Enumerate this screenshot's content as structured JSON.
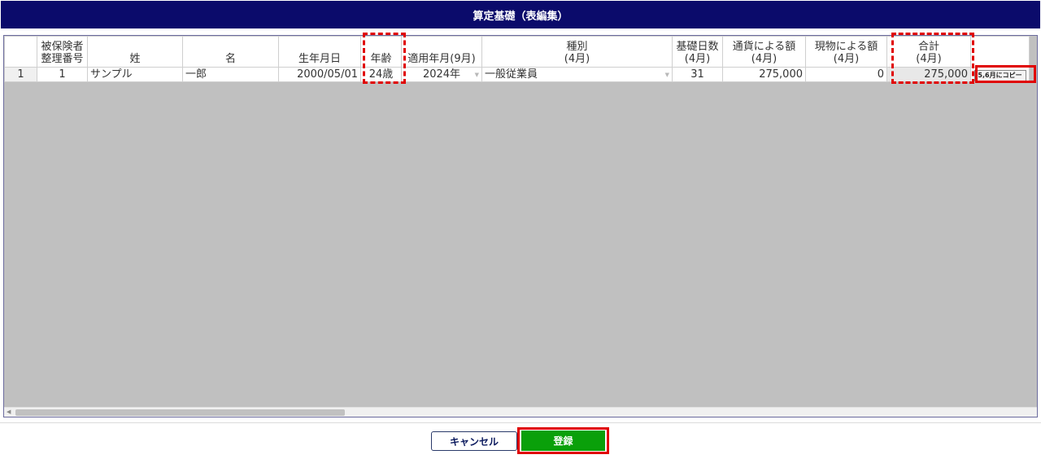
{
  "title": "算定基礎（表編集）",
  "columns": [
    {
      "key": "row",
      "label": ""
    },
    {
      "key": "insured_number",
      "label": "被保険者\n整理番号"
    },
    {
      "key": "last_name",
      "label": "姓"
    },
    {
      "key": "first_name",
      "label": "名"
    },
    {
      "key": "birth_date",
      "label": "生年月日"
    },
    {
      "key": "age",
      "label": "年齢"
    },
    {
      "key": "apply_month",
      "label": "適用年月(9月)"
    },
    {
      "key": "category",
      "label": "種別\n(4月)"
    },
    {
      "key": "base_days",
      "label": "基礎日数\n(4月)"
    },
    {
      "key": "currency_amount",
      "label": "通貨による額\n(4月)"
    },
    {
      "key": "goods_amount",
      "label": "現物による額\n(4月)"
    },
    {
      "key": "total",
      "label": "合計\n(4月)"
    },
    {
      "key": "action",
      "label": ""
    }
  ],
  "rows": [
    {
      "row": "1",
      "insured_number": "1",
      "last_name": "サンプル",
      "first_name": "一郎",
      "birth_date": "2000/05/01",
      "age": "24歳",
      "apply_month": "2024年",
      "category": "一般従業員",
      "base_days": "31",
      "currency_amount": "275,000",
      "goods_amount": "0",
      "total": "275,000",
      "action": "5,6月にコピー"
    }
  ],
  "buttons": {
    "cancel": "キャンセル",
    "register": "登録"
  },
  "colors": {
    "title_bar": "#0b0b6b",
    "register_button": "#0aa00a",
    "highlight": "#e00000",
    "grid_empty_area": "#c0c0c0"
  }
}
